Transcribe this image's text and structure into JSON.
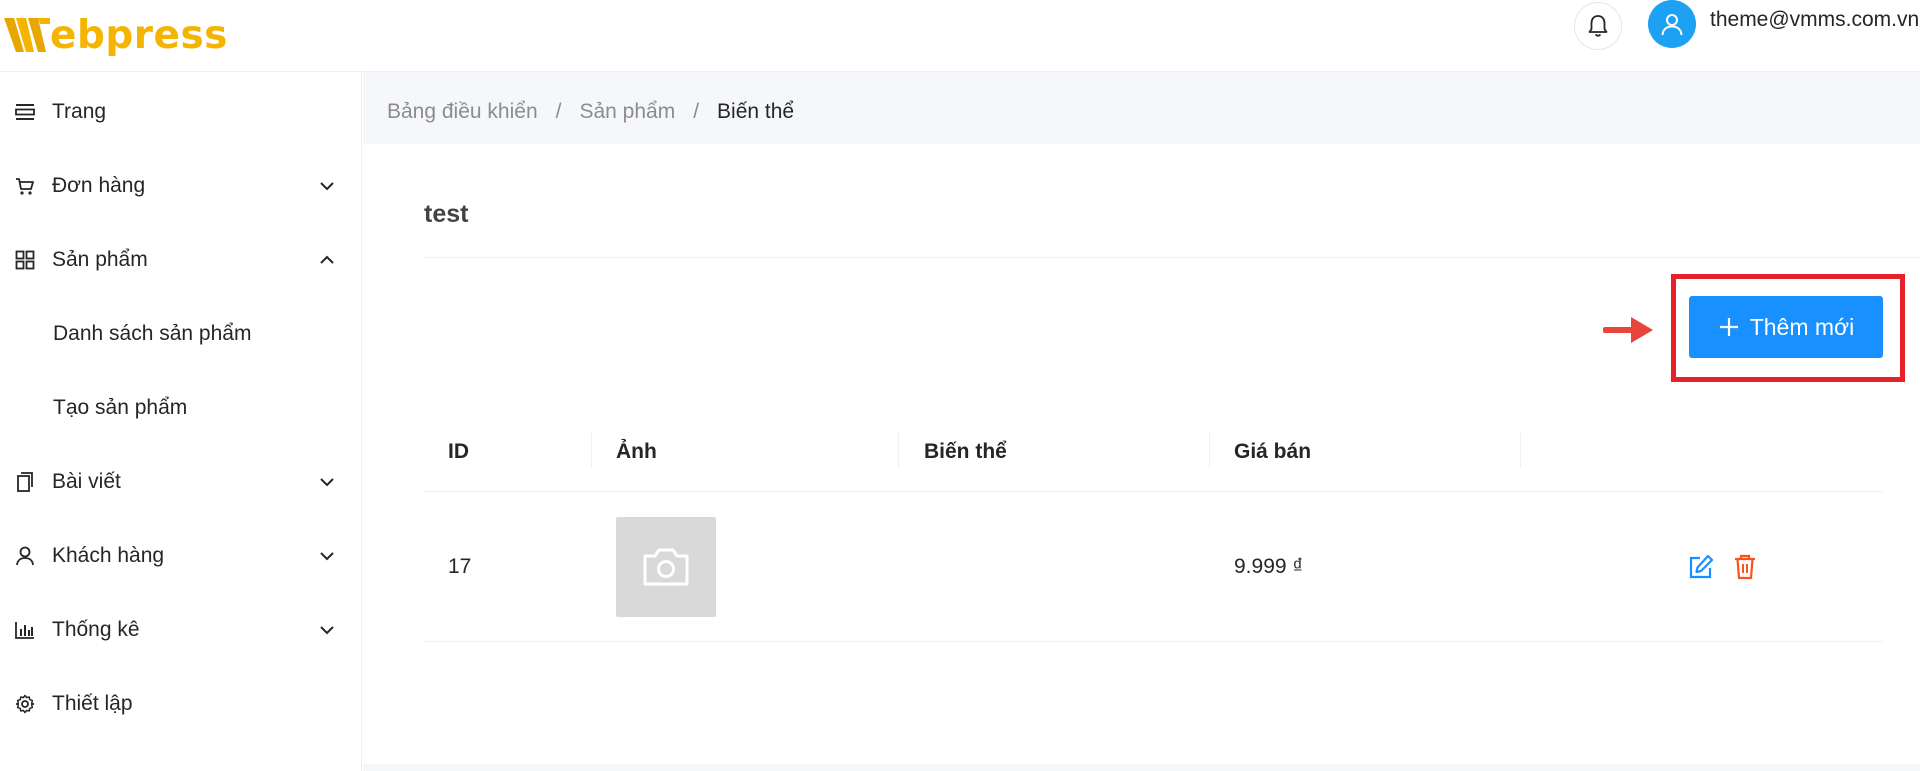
{
  "brand": {
    "logo_text": "ebpress",
    "color": "#f5b400"
  },
  "header": {
    "user_email": "theme@vmms.com.vn"
  },
  "sidebar": {
    "items": [
      {
        "label": "Trang",
        "icon": "layout-icon"
      },
      {
        "label": "Đơn hàng",
        "icon": "cart-icon",
        "chevron": "down"
      },
      {
        "label": "Sản phẩm",
        "icon": "grid-icon",
        "chevron": "up"
      },
      {
        "label": "Danh sách sản phẩm",
        "sub": true
      },
      {
        "label": "Tạo sản phẩm",
        "sub": true
      },
      {
        "label": "Bài viết",
        "icon": "copy-icon",
        "chevron": "down"
      },
      {
        "label": "Khách hàng",
        "icon": "user-icon",
        "chevron": "down"
      },
      {
        "label": "Thống kê",
        "icon": "bar-chart-icon",
        "chevron": "down"
      },
      {
        "label": "Thiết lập",
        "icon": "gear-icon"
      }
    ]
  },
  "breadcrumb": {
    "items": [
      "Bảng điều khiển",
      "Sản phẩm",
      "Biến thể"
    ],
    "separator": "/"
  },
  "card": {
    "title": "test",
    "add_button_label": "Thêm mới"
  },
  "table": {
    "columns": [
      "ID",
      "Ảnh",
      "Biến thể",
      "Giá bán",
      ""
    ],
    "rows": [
      {
        "id": "17",
        "image": "camera-icon",
        "variant": "",
        "price": "9.999 ₫"
      }
    ]
  },
  "colors": {
    "primary": "#1890ff",
    "highlight": "#e8202a",
    "delete": "#fa541c"
  }
}
